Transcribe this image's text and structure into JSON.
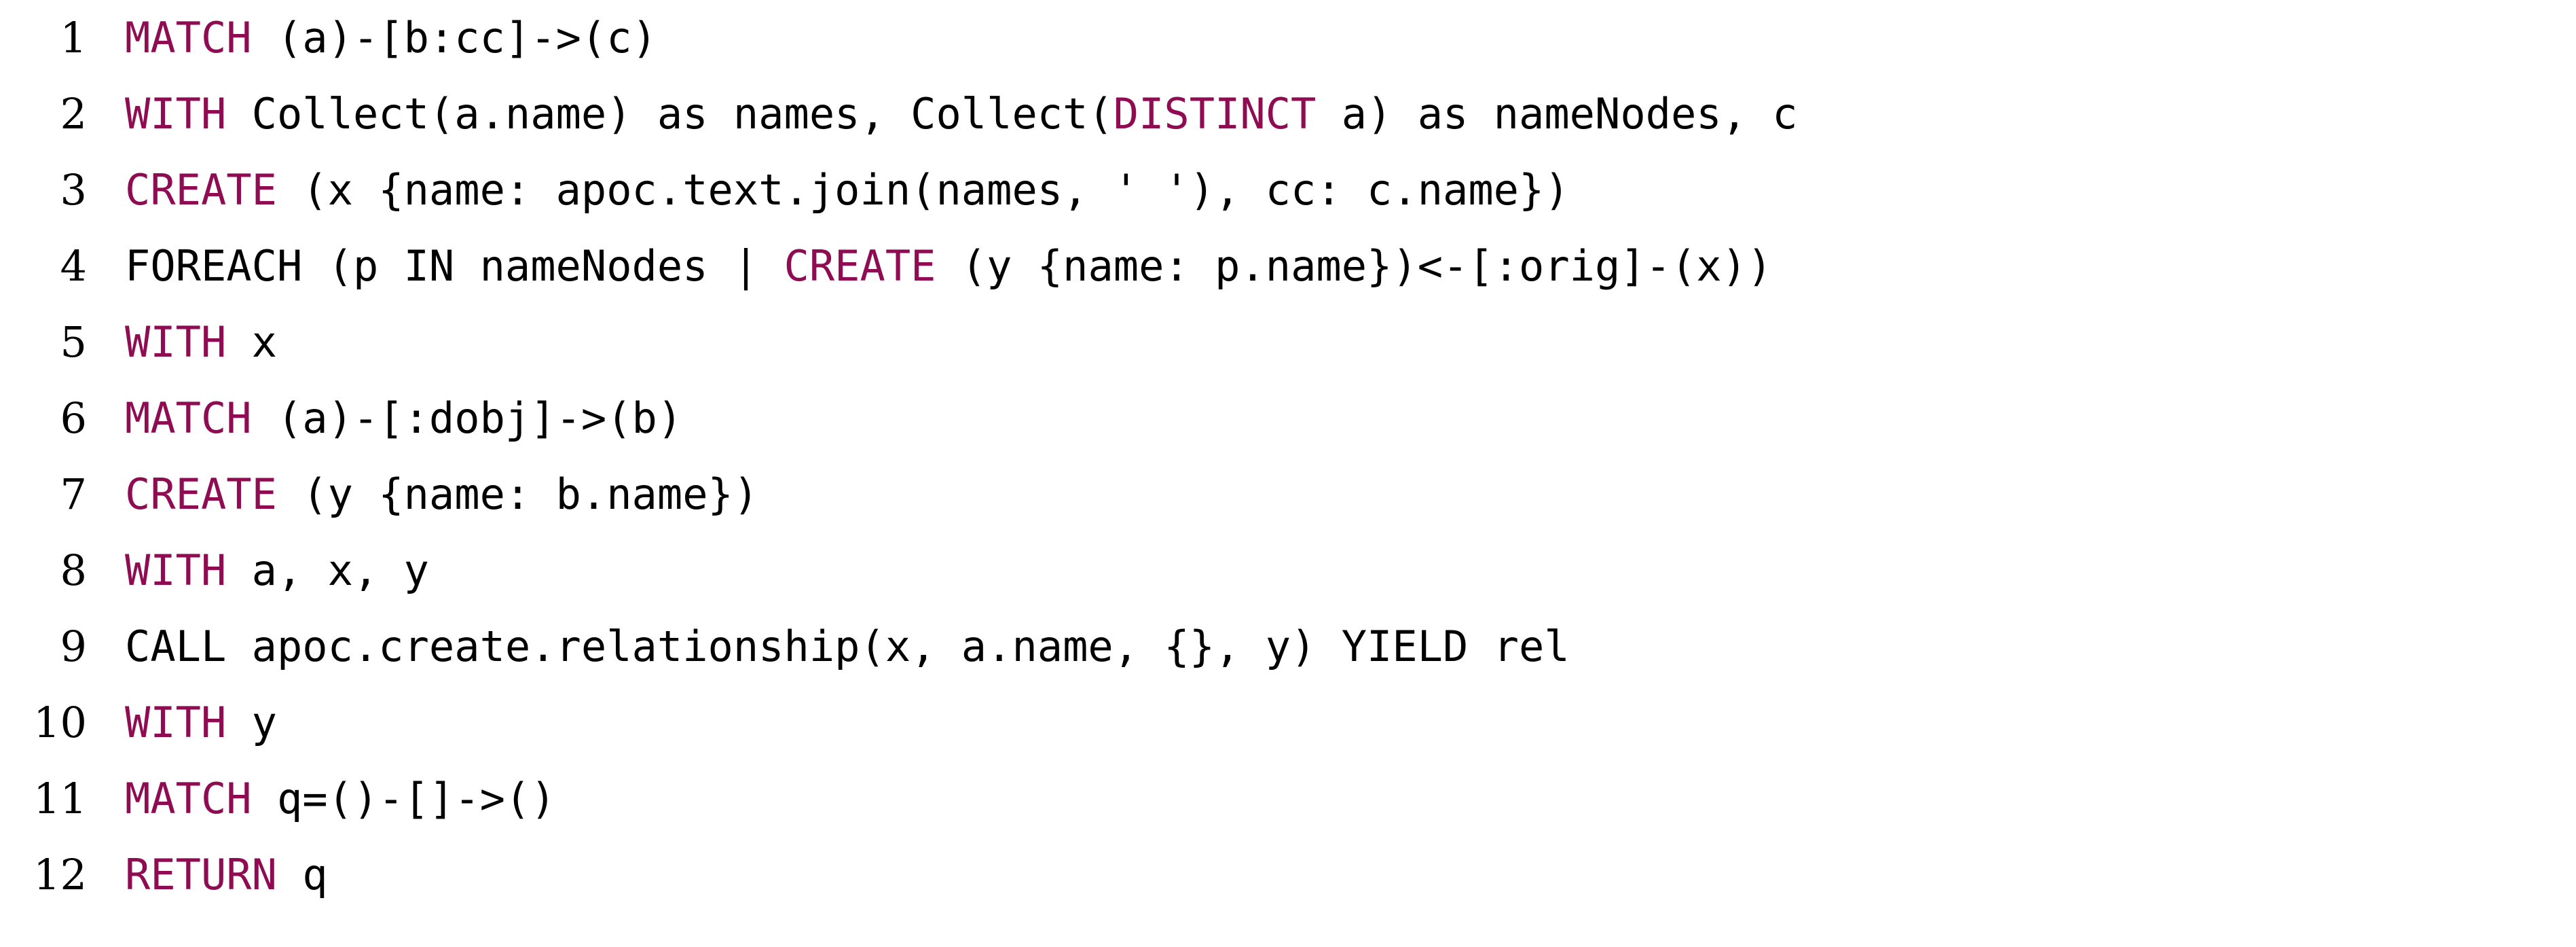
{
  "document": {
    "kind": "code-listing",
    "language": "Cypher",
    "background_color": "#ffffff",
    "keyword_color": "#8f0b52",
    "text_color": "#000000",
    "line_number_color": "#000000",
    "total_lines": 12
  },
  "lines": [
    {
      "number": "1",
      "text": "MATCH (a)-[b:cc]->(c)",
      "tokens": [
        {
          "t": "MATCH",
          "kw": true
        },
        {
          "t": " (a)-[b:cc]->(c)",
          "kw": false
        }
      ]
    },
    {
      "number": "2",
      "text": "WITH Collect(a.name) as names, Collect(DISTINCT a) as nameNodes, c",
      "tokens": [
        {
          "t": "WITH",
          "kw": true
        },
        {
          "t": " Collect(a.name) as names, Collect(",
          "kw": false
        },
        {
          "t": "DISTINCT",
          "kw": true
        },
        {
          "t": " a) as nameNodes, c",
          "kw": false
        }
      ]
    },
    {
      "number": "3",
      "text": "CREATE (x {name: apoc.text.join(names, ' '), cc: c.name})",
      "tokens": [
        {
          "t": "CREATE",
          "kw": true
        },
        {
          "t": " (x {name: apoc.text.join(names, ' '), cc: c.name})",
          "kw": false
        }
      ]
    },
    {
      "number": "4",
      "text": "FOREACH (p IN nameNodes | CREATE (y {name: p.name})<-[:orig]-(x))",
      "tokens": [
        {
          "t": "FOREACH (p IN nameNodes | ",
          "kw": false
        },
        {
          "t": "CREATE",
          "kw": true
        },
        {
          "t": " (y {name: p.name})<-[:orig]-(x))",
          "kw": false
        }
      ]
    },
    {
      "number": "5",
      "text": "WITH x",
      "tokens": [
        {
          "t": "WITH",
          "kw": true
        },
        {
          "t": " x",
          "kw": false
        }
      ]
    },
    {
      "number": "6",
      "text": "MATCH (a)-[:dobj]->(b)",
      "tokens": [
        {
          "t": "MATCH",
          "kw": true
        },
        {
          "t": " (a)-[:dobj]->(b)",
          "kw": false
        }
      ]
    },
    {
      "number": "7",
      "text": "CREATE (y {name: b.name})",
      "tokens": [
        {
          "t": "CREATE",
          "kw": true
        },
        {
          "t": " (y {name: b.name})",
          "kw": false
        }
      ]
    },
    {
      "number": "8",
      "text": "WITH a, x, y",
      "tokens": [
        {
          "t": "WITH",
          "kw": true
        },
        {
          "t": " a, x, y",
          "kw": false
        }
      ]
    },
    {
      "number": "9",
      "text": "CALL apoc.create.relationship(x, a.name, {}, y) YIELD rel",
      "tokens": [
        {
          "t": "CALL apoc.create.relationship(x, a.name, {}, y) YIELD rel",
          "kw": false
        }
      ]
    },
    {
      "number": "10",
      "text": "WITH y",
      "tokens": [
        {
          "t": "WITH",
          "kw": true
        },
        {
          "t": " y",
          "kw": false
        }
      ]
    },
    {
      "number": "11",
      "text": "MATCH q=()-[]->()",
      "tokens": [
        {
          "t": "MATCH",
          "kw": true
        },
        {
          "t": " q=()-[]->()",
          "kw": false
        }
      ]
    },
    {
      "number": "12",
      "text": "RETURN q",
      "tokens": [
        {
          "t": "RETURN",
          "kw": true
        },
        {
          "t": " q",
          "kw": false
        }
      ]
    }
  ]
}
